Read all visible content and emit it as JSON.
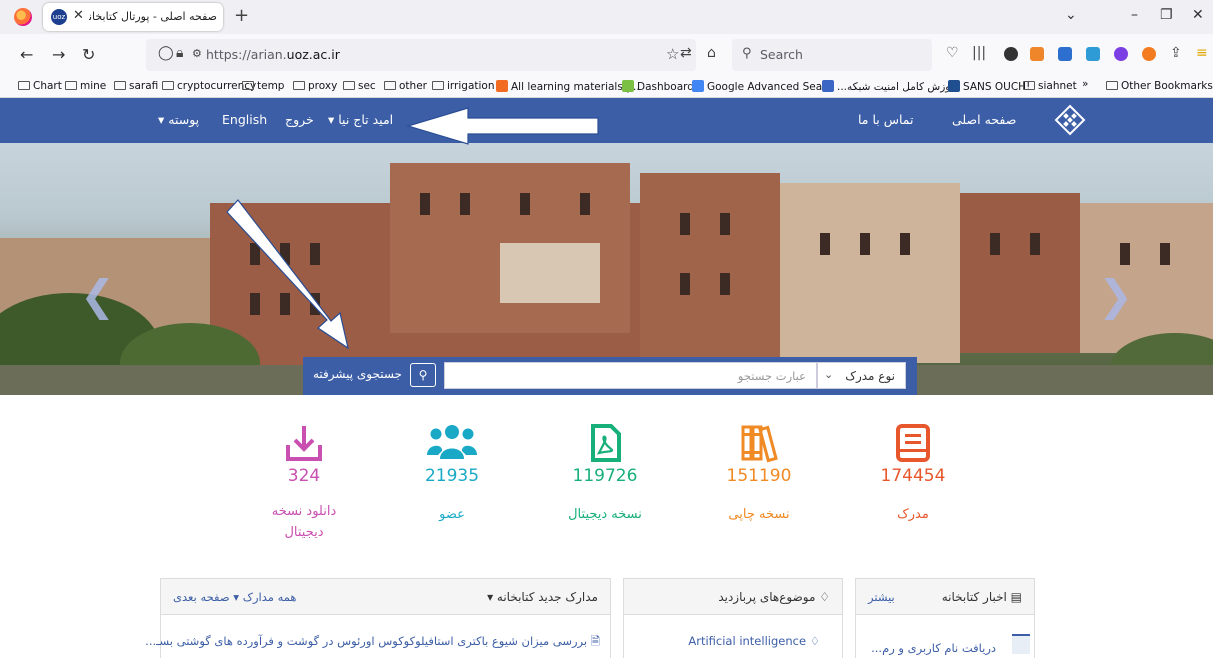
{
  "browser": {
    "tab_title": "صفحه اصلی - پورتال کتابخانه دا",
    "tab_favicon_text": "uoz",
    "url_prefix": "https://arian.",
    "url_domain": "uoz.ac.ir",
    "search_placeholder": "Search",
    "bookmarks": [
      {
        "label": "Chart",
        "kind": "folder"
      },
      {
        "label": "mine",
        "kind": "folder"
      },
      {
        "label": "sarafi",
        "kind": "folder"
      },
      {
        "label": "cryptocurrency",
        "kind": "folder"
      },
      {
        "label": "temp",
        "kind": "folder"
      },
      {
        "label": "proxy",
        "kind": "folder"
      },
      {
        "label": "sec",
        "kind": "folder"
      },
      {
        "label": "other",
        "kind": "folder"
      },
      {
        "label": "irrigation",
        "kind": "folder"
      },
      {
        "label": "All learning materials |...",
        "kind": "favicon",
        "color": "#f26b21"
      },
      {
        "label": "Dashboard",
        "kind": "favicon",
        "color": "#7bc043"
      },
      {
        "label": "Google Advanced Sea...",
        "kind": "favicon",
        "color": "#4285f4"
      },
      {
        "label": "...وزش کامل امنیت شبکه",
        "kind": "favicon",
        "color": "#3b66c4"
      },
      {
        "label": "SANS OUCH!",
        "kind": "favicon",
        "color": "#1f4f8f"
      },
      {
        "label": "siahnet",
        "kind": "folder"
      }
    ],
    "bookmarks_more": "Other Bookmarks"
  },
  "site_nav": {
    "home": "صفحه اصلی",
    "contact": "تماس با ما",
    "user": "امید تاج نیا ▾",
    "logout": "خروج",
    "english": "English",
    "skin": "پوسته ▾"
  },
  "search": {
    "advanced": "جستجوی پیشرفته",
    "placeholder": "عبارت جستجو",
    "doc_type": "نوع مدرک"
  },
  "stats": [
    {
      "value": "174454",
      "label": "مدرک",
      "color": "#e8572c",
      "icon": "book-icon"
    },
    {
      "value": "151190",
      "label": "نسخه چاپی",
      "color": "#f08a24",
      "icon": "books-icon"
    },
    {
      "value": "119726",
      "label": "نسخه دیجیتال",
      "color": "#18b07a",
      "icon": "pdf-icon"
    },
    {
      "value": "21935",
      "label": "عضو",
      "color": "#19a9c6",
      "icon": "users-icon"
    },
    {
      "value": "324",
      "label_line1": "دانلود نسخه",
      "label_line2": "دیجیتال",
      "color": "#c94fb0",
      "icon": "download-icon"
    }
  ],
  "panels": {
    "news": {
      "title": "▤ اخبار کتابخانه",
      "more": "بیشتر",
      "item": "دریافت نام کاربری و رم..."
    },
    "topics": {
      "title": "♢ موضوع‌های پربازدید",
      "item": "Artificial intelligence ♢"
    },
    "docs": {
      "title": "مدارک جدید کتابخانه ▾",
      "links": "همه مدارک ▾   صفحه بعدی",
      "item": "بررسی میزان شیوع باکتری استافیلوکوکوس اورئوس در گوشت و فرآورده های گوشتی بسـ..."
    }
  },
  "colors": {
    "brand": "#3c5ea6",
    "annotation_arrow": "#ffffff"
  }
}
